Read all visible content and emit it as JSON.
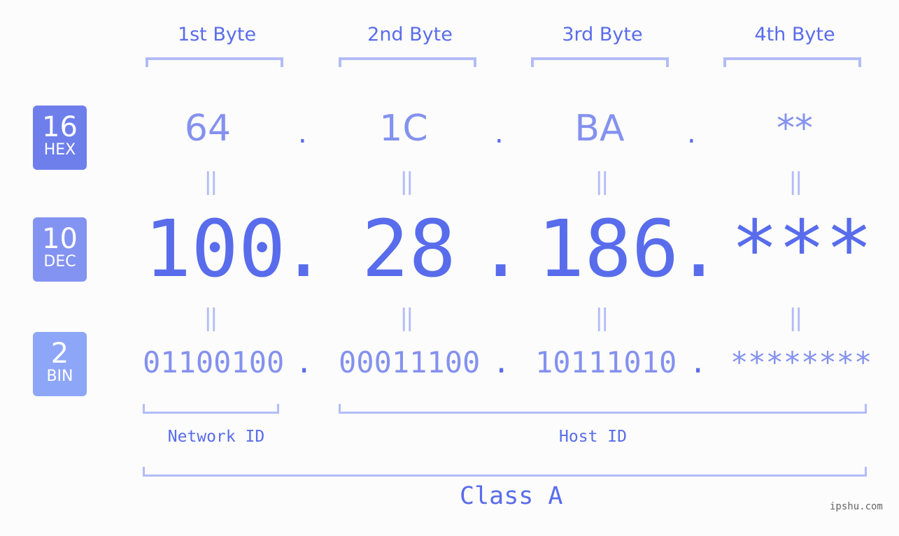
{
  "byte_headers": [
    "1st Byte",
    "2nd Byte",
    "3rd Byte",
    "4th Byte"
  ],
  "badges": {
    "hex": {
      "number": "16",
      "label": "HEX",
      "color": "#6e7fec"
    },
    "dec": {
      "number": "10",
      "label": "DEC",
      "color": "#8393f1"
    },
    "bin": {
      "number": "2",
      "label": "BIN",
      "color": "#8ea6f7"
    }
  },
  "hex_values": [
    "64",
    "1C",
    "BA",
    "**"
  ],
  "dec_values": [
    "100",
    "28",
    "186",
    "***"
  ],
  "bin_values": [
    "01100100",
    "00011100",
    "10111010",
    "********"
  ],
  "separator": ".",
  "equals_symbol": "||",
  "network_label": "Network ID",
  "host_label": "Host ID",
  "class_label": "Class A",
  "watermark": "ipshu.com",
  "colors": {
    "accent": "#586cec",
    "light_value": "#8491ef",
    "bracket": "#b3bcf8",
    "background": "#fbfcfb"
  }
}
